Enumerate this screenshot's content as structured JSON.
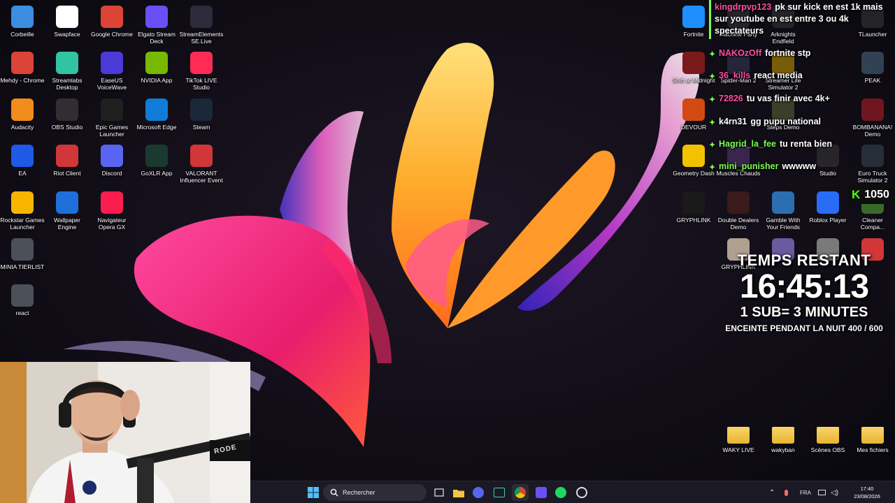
{
  "desktop": {
    "left_icons": [
      {
        "label": "Corbeille",
        "icon": "recycle-bin-icon",
        "color": "#3b8de0"
      },
      {
        "label": "Swapface",
        "icon": "mask-icon",
        "color": "#ffffff"
      },
      {
        "label": "Google Chrome",
        "icon": "chrome-icon",
        "color": "#db4437"
      },
      {
        "label": "Elgato Stream Deck",
        "icon": "stream-deck-icon",
        "color": "#6b4ff6"
      },
      {
        "label": "StreamElements SE.Live",
        "icon": "streamelements-icon",
        "color": "#2b2b3a"
      },
      {
        "label": "Mehdy - Chrome",
        "icon": "chrome-profile-icon",
        "color": "#db4437"
      },
      {
        "label": "Streamlabs Desktop",
        "icon": "streamlabs-icon",
        "color": "#31c3a2"
      },
      {
        "label": "EaseUS VoiceWave",
        "icon": "voicewave-icon",
        "color": "#4a3ad8"
      },
      {
        "label": "NVIDIA App",
        "icon": "nvidia-icon",
        "color": "#76b900"
      },
      {
        "label": "TikTok LIVE Studio",
        "icon": "tiktok-icon",
        "color": "#fe2c55"
      },
      {
        "label": "Audacity",
        "icon": "audacity-icon",
        "color": "#f28c1c"
      },
      {
        "label": "OBS Studio",
        "icon": "obs-icon",
        "color": "#302e31"
      },
      {
        "label": "Epic Games Launcher",
        "icon": "epic-games-icon",
        "color": "#202020"
      },
      {
        "label": "Microsoft Edge",
        "icon": "edge-icon",
        "color": "#0f7dd8"
      },
      {
        "label": "Steam",
        "icon": "steam-icon",
        "color": "#1b2838"
      },
      {
        "label": "EA",
        "icon": "ea-icon",
        "color": "#1e5ae6"
      },
      {
        "label": "Riot Client",
        "icon": "riot-icon",
        "color": "#d13639"
      },
      {
        "label": "Discord",
        "icon": "discord-icon",
        "color": "#5865f2"
      },
      {
        "label": "GoXLR App",
        "icon": "goxlr-icon",
        "color": "#1a3a30"
      },
      {
        "label": "VALORANT Influencer Event",
        "icon": "valorant-icon",
        "color": "#d13639"
      },
      {
        "label": "Rockstar Games Launcher",
        "icon": "rockstar-icon",
        "color": "#f7b500"
      },
      {
        "label": "Wallpaper Engine",
        "icon": "wallpaper-engine-icon",
        "color": "#1e6fd9"
      },
      {
        "label": "Navigateur Opera GX",
        "icon": "opera-gx-icon",
        "color": "#fa1e4e"
      },
      {
        "label": "MINIA TIERLIST",
        "icon": "thumbnail-icon",
        "color": "#4c5058"
      },
      {
        "label": "react",
        "icon": "thumbnail-icon",
        "color": "#4c5058"
      }
    ],
    "right_icons": [
      {
        "label": "Fortnite",
        "icon": "fortnite-icon",
        "color": "#1f8fff"
      },
      {
        "label": "Machine Party",
        "icon": "game-icon",
        "color": "#3a3a3a"
      },
      {
        "label": "Arknights Endfield",
        "icon": "game-icon",
        "color": "#3a3a3a"
      },
      {
        "label": "TLauncher",
        "icon": "game-icon",
        "color": "#3a3a3a"
      },
      {
        "label": "Shift at Midnight",
        "icon": "game-icon",
        "color": "#7a1a1a"
      },
      {
        "label": "Spider-Man 2",
        "icon": "game-icon",
        "color": "#3a3a5a"
      },
      {
        "label": "Streamer Life Simulator 2",
        "icon": "game-icon",
        "color": "#cfa000"
      },
      {
        "label": "PEAK",
        "icon": "game-icon",
        "color": "#50708a"
      },
      {
        "label": "DEVOUR",
        "icon": "devour-icon",
        "color": "#d14a12"
      },
      {
        "label": "Steps Demo",
        "icon": "game-icon",
        "color": "#5a6a3a"
      },
      {
        "label": "BOMBANANA! Demo",
        "icon": "game-icon",
        "color": "#c0202a"
      },
      {
        "label": "Geometry Dash",
        "icon": "geometry-dash-icon",
        "color": "#f2c200"
      },
      {
        "label": "Muscles Chauds",
        "icon": "game-icon",
        "color": "#5a3a7a"
      },
      {
        "label": "Studio",
        "icon": "game-icon",
        "color": "#3a3a3a"
      },
      {
        "label": "Euro Truck Simulator 2",
        "icon": "truck-icon",
        "color": "#3a4a5a"
      },
      {
        "label": "GRYPHLINK",
        "icon": "gryphlink-icon",
        "color": "#1a1a1a"
      },
      {
        "label": "Double Dealers Demo",
        "icon": "game-icon",
        "color": "#3a1a1a"
      },
      {
        "label": "Gamble With Your Friends",
        "icon": "game-icon",
        "color": "#2b6fb0"
      },
      {
        "label": "Roblox Player",
        "icon": "roblox-icon",
        "color": "#2a6cf5"
      },
      {
        "label": "Cleaner Compa...",
        "icon": "game-icon",
        "color": "#3a6a2a"
      },
      {
        "label": "GRYPHLINK",
        "icon": "game-icon",
        "color": "#b0a090"
      },
      {
        "label": "",
        "icon": "game-icon",
        "color": "#6a5aa0"
      },
      {
        "label": "",
        "icon": "game-icon",
        "color": "#7a7a7a"
      },
      {
        "label": "",
        "icon": "valorant-icon",
        "color": "#d13639"
      }
    ],
    "folders": [
      {
        "label": "WAKY LIVE"
      },
      {
        "label": "wakyban"
      },
      {
        "label": "Scènes OBS"
      },
      {
        "label": "Mes fichiers"
      }
    ]
  },
  "chat": {
    "messages": [
      {
        "user": "kingdrpvp123",
        "text": "pk sur kick en est 1k mais sur youtube en est entre 3 ou 4k spectateurs",
        "style": "pink"
      },
      {
        "user": "NAKOzOff",
        "text": "fortnite stp",
        "style": "pink"
      },
      {
        "user": "36_kills",
        "text": "react media",
        "style": "pink"
      },
      {
        "user": "72826",
        "text": "tu vas finir avec 4k+",
        "style": "pink"
      },
      {
        "user": "k4rn31",
        "text": "gg pupu national",
        "style": "white"
      },
      {
        "user": "Hagrid_la_fee",
        "text": "tu renta bien",
        "style": "green"
      },
      {
        "user": "mini_punisher",
        "text": "wwwww",
        "style": "green"
      }
    ]
  },
  "kick_badge": {
    "letter": "K",
    "count": "1050"
  },
  "timer": {
    "title": "TEMPS RESTANT",
    "time": "16:45:13",
    "rule": "1 SUB= 3 MINUTES",
    "goal": "ENCEINTE PENDANT LA NUIT 400 / 600"
  },
  "taskbar": {
    "search_label": "Rechercher",
    "language": "FRA",
    "time": "17:40",
    "date": "23/08/2026"
  },
  "webcam": {
    "mic_brand": "RODE"
  }
}
